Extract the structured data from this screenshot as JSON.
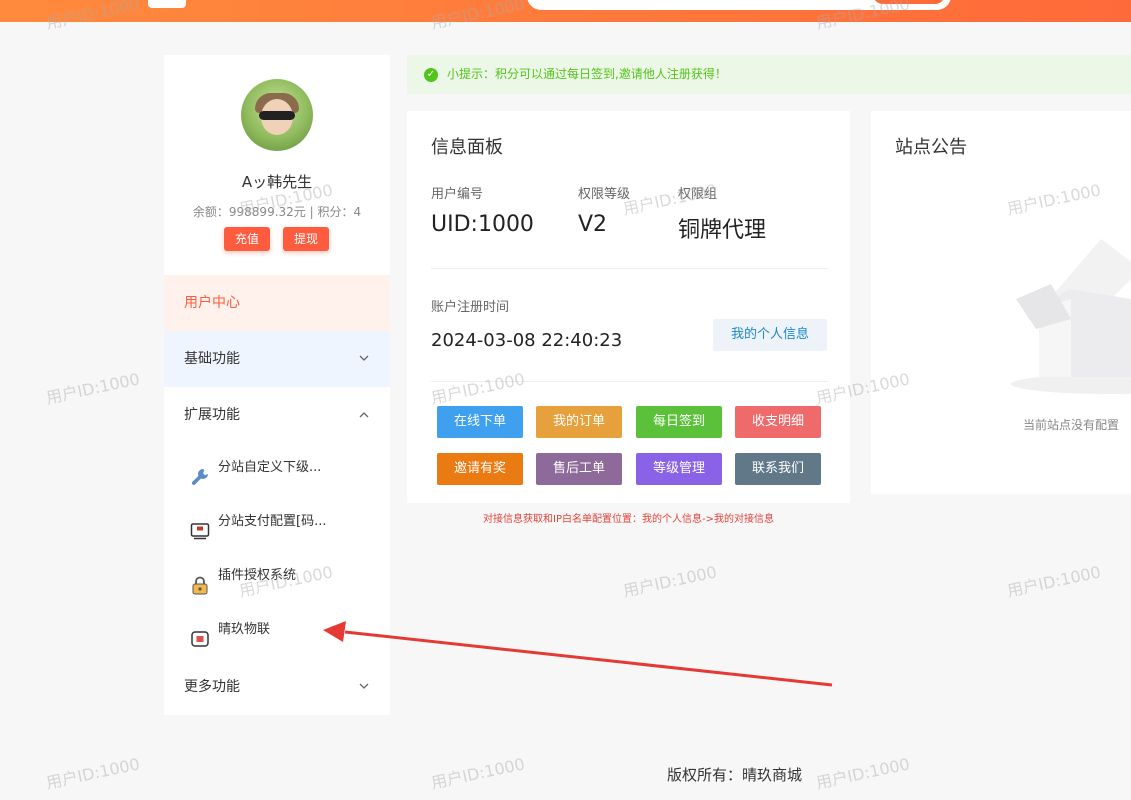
{
  "watermark": "用户ID:1000",
  "user": {
    "name": "Aッ韩先生",
    "balance_text": "余额：998899.32元 | 积分：4",
    "recharge_label": "充值",
    "withdraw_label": "提现"
  },
  "sidebar": {
    "user_center": "用户中心",
    "basic": "基础功能",
    "extended": "扩展功能",
    "more": "更多功能",
    "sub_items": [
      {
        "label": "分站自定义下级...",
        "icon": "wrench-icon"
      },
      {
        "label": "分站支付配置[码...",
        "icon": "payment-terminal-icon"
      },
      {
        "label": "插件授权系统",
        "icon": "lock-icon"
      },
      {
        "label": "晴玖物联",
        "icon": "chip-icon"
      }
    ]
  },
  "notice": {
    "text": "小提示：积分可以通过每日签到,邀请他人注册获得！"
  },
  "info_panel": {
    "title": "信息面板",
    "uid_label": "用户编号",
    "uid_value": "UID:1000",
    "level_label": "权限等级",
    "level_value": "V2",
    "group_label": "权限组",
    "group_value": "铜牌代理",
    "reg_label": "账户注册时间",
    "reg_value": "2024-03-08 22:40:23",
    "my_info_button": "我的个人信息"
  },
  "quick_buttons": [
    {
      "label": "在线下单",
      "color": "#3fa0f0"
    },
    {
      "label": "我的订单",
      "color": "#e6a03c"
    },
    {
      "label": "每日签到",
      "color": "#5cc13a"
    },
    {
      "label": "收支明细",
      "color": "#ef6b6b"
    },
    {
      "label": "邀请有奖",
      "color": "#ea7a12"
    },
    {
      "label": "售后工单",
      "color": "#8d6a9a"
    },
    {
      "label": "等级管理",
      "color": "#8a62e8"
    },
    {
      "label": "联系我们",
      "color": "#607888"
    }
  ],
  "docking_hint": "对接信息获取和IP白名单配置位置：我的个人信息->我的对接信息",
  "announcement": {
    "title": "站点公告",
    "empty_text": "当前站点没有配置"
  },
  "footer": {
    "copyright": "版权所有：晴玖商城"
  },
  "colors": {
    "accent": "#ff6a3a",
    "active_menu_bg": "#fff1ec",
    "active_menu_text": "#ff5c3f",
    "basic_menu_bg": "#eef5ff",
    "arrow": "#e53935"
  }
}
